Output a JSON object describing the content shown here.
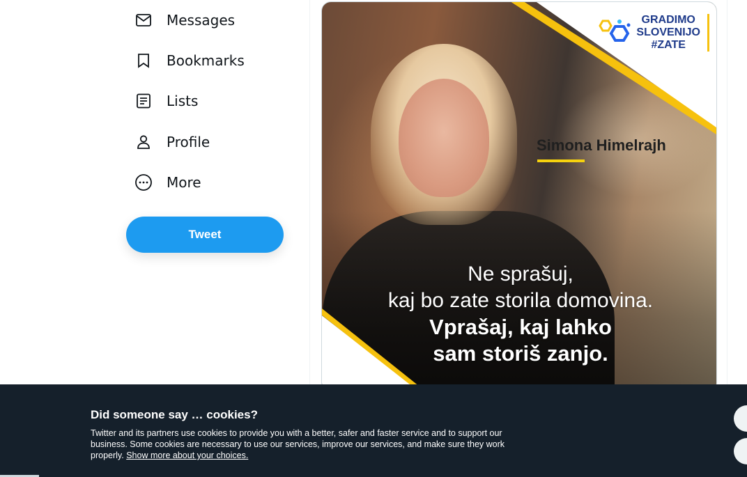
{
  "nav": {
    "items": [
      {
        "label": "Messages",
        "icon": "envelope-icon"
      },
      {
        "label": "Bookmarks",
        "icon": "bookmark-icon"
      },
      {
        "label": "Lists",
        "icon": "list-icon"
      },
      {
        "label": "Profile",
        "icon": "person-icon"
      },
      {
        "label": "More",
        "icon": "more-circle-icon"
      }
    ],
    "tweet_label": "Tweet"
  },
  "media": {
    "logo_line1": "GRADIMO",
    "logo_line2": "SLOVENIJO",
    "logo_line3": "#ZATE",
    "name": "Simona Himelrajh",
    "quote_line1": "Ne sprašuj,",
    "quote_line2": "kaj bo zate storila domovina.",
    "quote_line3": "Vprašaj, kaj lahko",
    "quote_line4": "sam storiš zanjo."
  },
  "cookie": {
    "title": "Did someone say … cookies?",
    "text": "Twitter and its partners use cookies to provide you with a better, safer and faster service and to support our business. Some cookies are necessary to use our services, improve our services, and make sure they work properly.",
    "link": "Show more about your choices."
  },
  "colors": {
    "accent": "#1d9bf0",
    "banner": "#15202b",
    "stripe": "#f6c10e"
  }
}
